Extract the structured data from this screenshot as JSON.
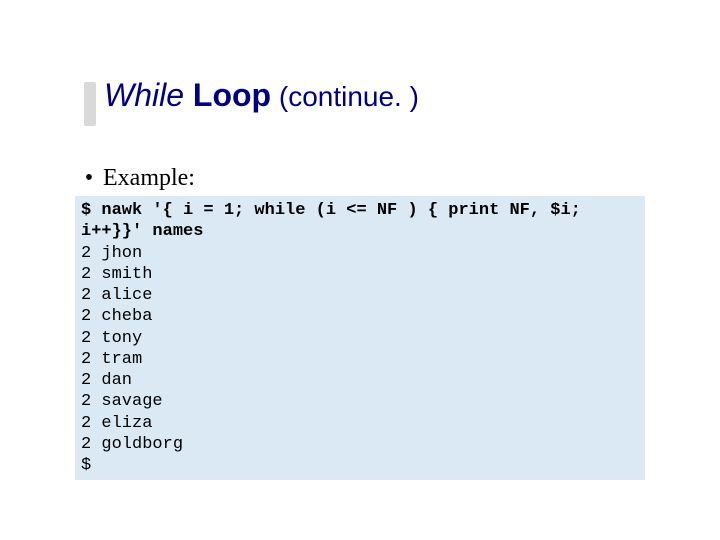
{
  "title": {
    "italic_part": "While",
    "bold_part": " Loop",
    "tail_part": " (continue. )"
  },
  "bullet_label": "Example:",
  "code": {
    "command": "$ nawk '{ i = 1; while (i <= NF ) { print NF, $i; i++}}' names",
    "output": "2 jhon\n2 smith\n2 alice\n2 cheba\n2 tony\n2 tram\n2 dan\n2 savage\n2 eliza\n2 goldborg\n$"
  }
}
